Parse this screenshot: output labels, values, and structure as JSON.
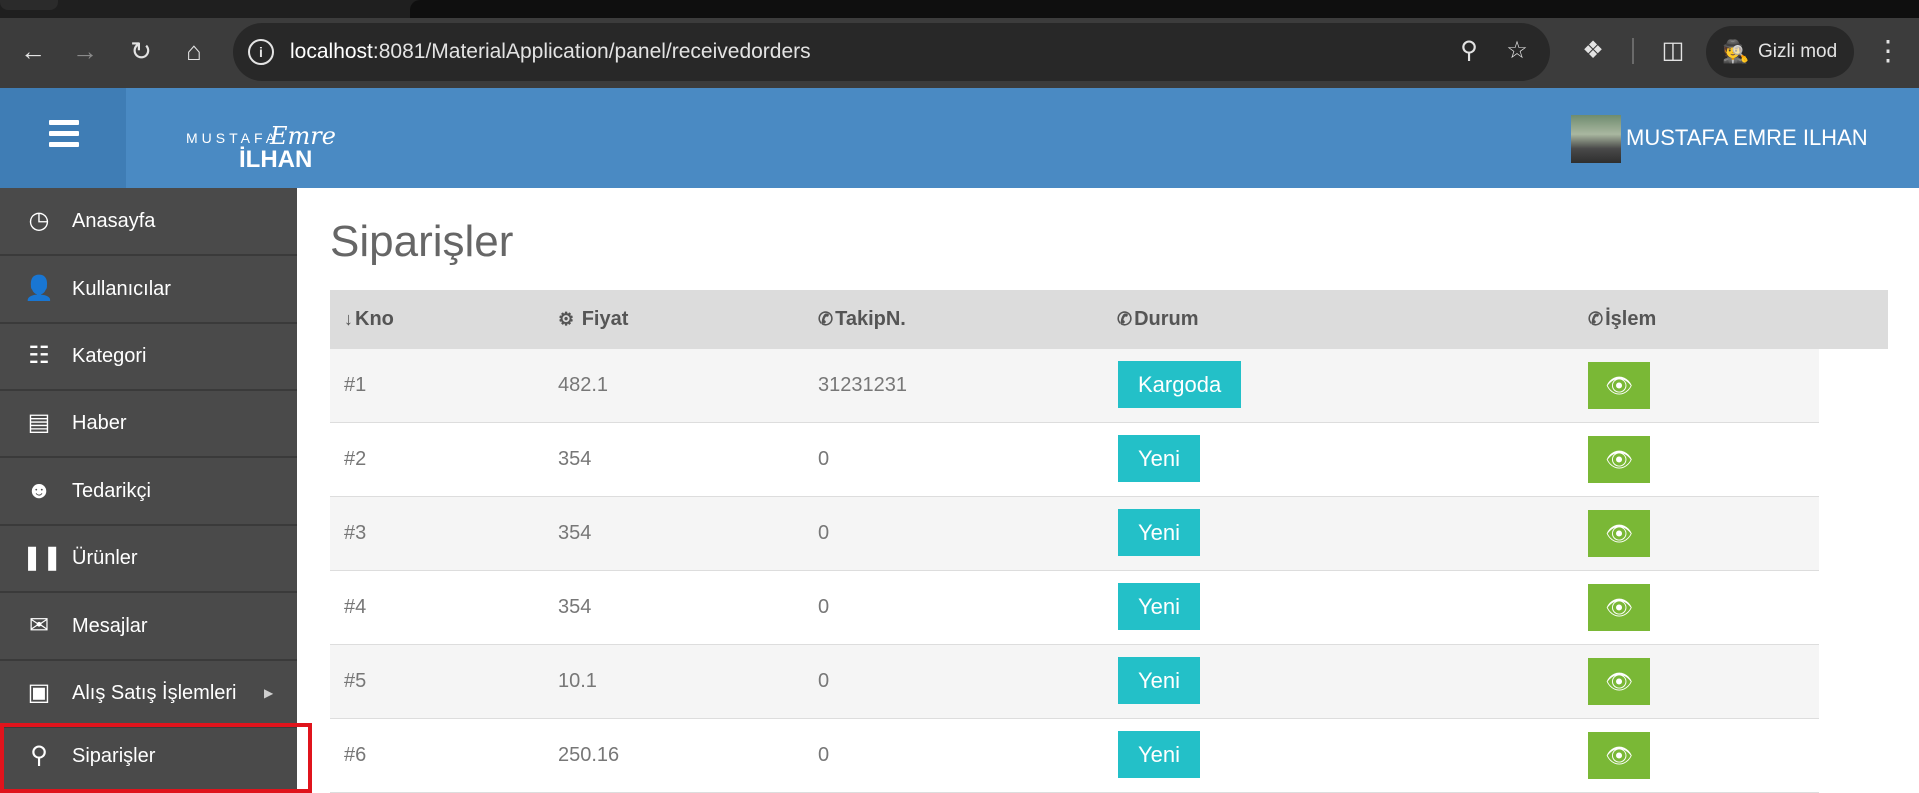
{
  "browser": {
    "url_host": "localhost",
    "url_rest": ":8081/MaterialApplication/panel/receivedorders",
    "incognito_label": "Gizli mod",
    "icons": [
      "back-icon",
      "forward-icon",
      "reload-icon",
      "home-icon",
      "site-info-icon",
      "zoom-icon",
      "star-icon",
      "extensions-icon",
      "side-panel-icon",
      "incognito-icon",
      "more-menu-icon"
    ]
  },
  "header": {
    "logo": {
      "line1": "MUSTAFA",
      "line2": "Emre",
      "line3": "İLHAN"
    },
    "user_name": "MUSTAFA EMRE ILHAN",
    "colors": {
      "header_bg": "#4a8ac3",
      "hamburger_bg": "#3f7db5"
    }
  },
  "sidebar": {
    "items": [
      {
        "label": "Anasayfa",
        "icon": "dashboard-icon"
      },
      {
        "label": "Kullanıcılar",
        "icon": "user-icon"
      },
      {
        "label": "Kategori",
        "icon": "sitemap-icon"
      },
      {
        "label": "Haber",
        "icon": "book-icon"
      },
      {
        "label": "Tedarikçi",
        "icon": "users-icon"
      },
      {
        "label": "Ürünler",
        "icon": "barcode-icon"
      },
      {
        "label": "Mesajlar",
        "icon": "envelope-icon"
      },
      {
        "label": "Alış Satış İşlemleri",
        "icon": "money-icon",
        "has_submenu": true
      },
      {
        "label": "Siparişler",
        "icon": "map-marker-icon",
        "highlighted": true
      }
    ]
  },
  "main": {
    "title": "Siparişler",
    "columns": [
      {
        "label": "Kno",
        "icon": "sort-numeric-icon"
      },
      {
        "label": "Fiyat",
        "icon": "cogs-icon"
      },
      {
        "label": "TakipN.",
        "icon": "phone-icon"
      },
      {
        "label": "Durum",
        "icon": "phone-icon"
      },
      {
        "label": "İşlem",
        "icon": "phone-icon"
      }
    ],
    "rows": [
      {
        "kno": "#1",
        "fiyat": "482.1",
        "takip": "31231231",
        "durum": "Kargoda"
      },
      {
        "kno": "#2",
        "fiyat": "354",
        "takip": "0",
        "durum": "Yeni"
      },
      {
        "kno": "#3",
        "fiyat": "354",
        "takip": "0",
        "durum": "Yeni"
      },
      {
        "kno": "#4",
        "fiyat": "354",
        "takip": "0",
        "durum": "Yeni"
      },
      {
        "kno": "#5",
        "fiyat": "10.1",
        "takip": "0",
        "durum": "Yeni"
      },
      {
        "kno": "#6",
        "fiyat": "250.16",
        "takip": "0",
        "durum": "Yeni"
      }
    ],
    "colors": {
      "badge": "#23c0c8",
      "action_button": "#7ab836",
      "highlight_outline": "#e0141c"
    }
  }
}
